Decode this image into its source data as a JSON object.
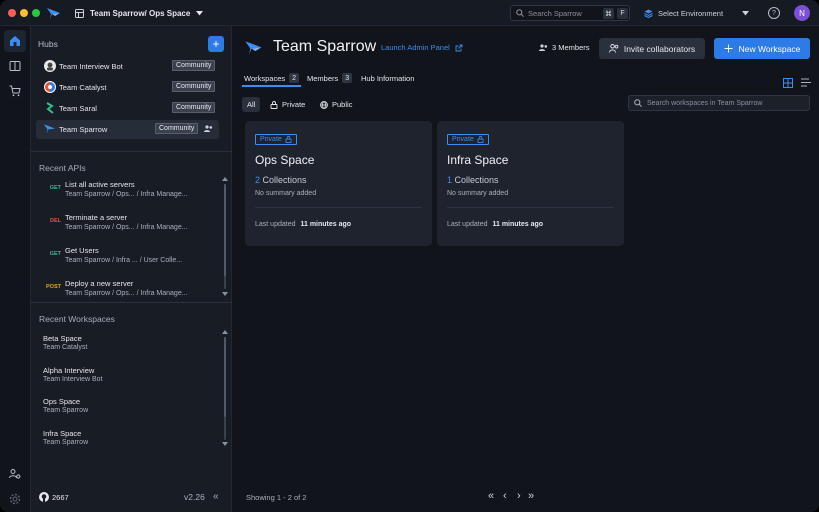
{
  "titlebar": {
    "workspace_path": "Team Sparrow/ Ops Space",
    "search_placeholder": "Search Sparrow",
    "search_kbd_1": "⌘",
    "search_kbd_2": "F",
    "environment": "Select Environment",
    "help": "?",
    "avatar_initial": "N"
  },
  "sidebar": {
    "hubs_title": "Hubs",
    "add_label": "+",
    "hubs": [
      {
        "name": "Team Interview Bot",
        "badge": "Community"
      },
      {
        "name": "Team Catalyst",
        "badge": "Community"
      },
      {
        "name": "Team Saral",
        "badge": "Community"
      },
      {
        "name": "Team Sparrow",
        "badge": "Community"
      }
    ],
    "recent_apis_title": "Recent APIs",
    "recent_apis": [
      {
        "method": "GET",
        "name": "List all active servers",
        "path": "Team Sparrow / Ops...  /   Infra Manage..."
      },
      {
        "method": "DEL",
        "name": "Terminate a server",
        "path": "Team Sparrow / Ops...  /   Infra Manage..."
      },
      {
        "method": "GET",
        "name": "Get Users",
        "path": "Team Sparrow / Infra ...  /   User Colle..."
      },
      {
        "method": "POST",
        "name": "Deploy a new server",
        "path": "Team Sparrow / Ops...  /   Infra Manage..."
      }
    ],
    "recent_workspaces_title": "Recent Workspaces",
    "recent_workspaces": [
      {
        "name": "Beta Space",
        "hub": "Team Catalyst"
      },
      {
        "name": "Alpha Interview",
        "hub": "Team Interview Bot"
      },
      {
        "name": "Ops Space",
        "hub": "Team Sparrow"
      },
      {
        "name": "Infra Space",
        "hub": "Team Sparrow"
      }
    ],
    "github_stars": "2667",
    "version": "v2.26",
    "collapse": "«"
  },
  "main": {
    "title": "Team Sparrow",
    "admin_link": "Launch Admin Panel",
    "members": "3 Members",
    "invite_label": "Invite collaborators",
    "new_workspace_label": "New Workspace",
    "tabs": [
      {
        "label": "Workspaces",
        "count": "2"
      },
      {
        "label": "Members",
        "count": "3"
      },
      {
        "label": "Hub Information",
        "count": ""
      }
    ],
    "filters": [
      "All",
      "Private",
      "Public"
    ],
    "search_placeholder": "Search workspaces in Team Sparrow",
    "cards": [
      {
        "badge": "Private",
        "title": "Ops Space",
        "collections_count": "2",
        "collections_label": "Collections",
        "summary": "No summary added",
        "updated_label": "Last updated",
        "updated_value": "11 minutes ago"
      },
      {
        "badge": "Private",
        "title": "Infra Space",
        "collections_count": "1",
        "collections_label": "Collections",
        "summary": "No summary added",
        "updated_label": "Last updated",
        "updated_value": "11 minutes ago"
      }
    ],
    "showing": "Showing 1 - 2 of 2",
    "pager": {
      "first": "«",
      "prev": "‹",
      "next": "›",
      "last": "»"
    }
  },
  "colors": {
    "accent": "#2d7be6",
    "link": "#3d8df0",
    "get": "#2fbf8f",
    "del": "#e5533d",
    "post": "#e6a23c"
  }
}
